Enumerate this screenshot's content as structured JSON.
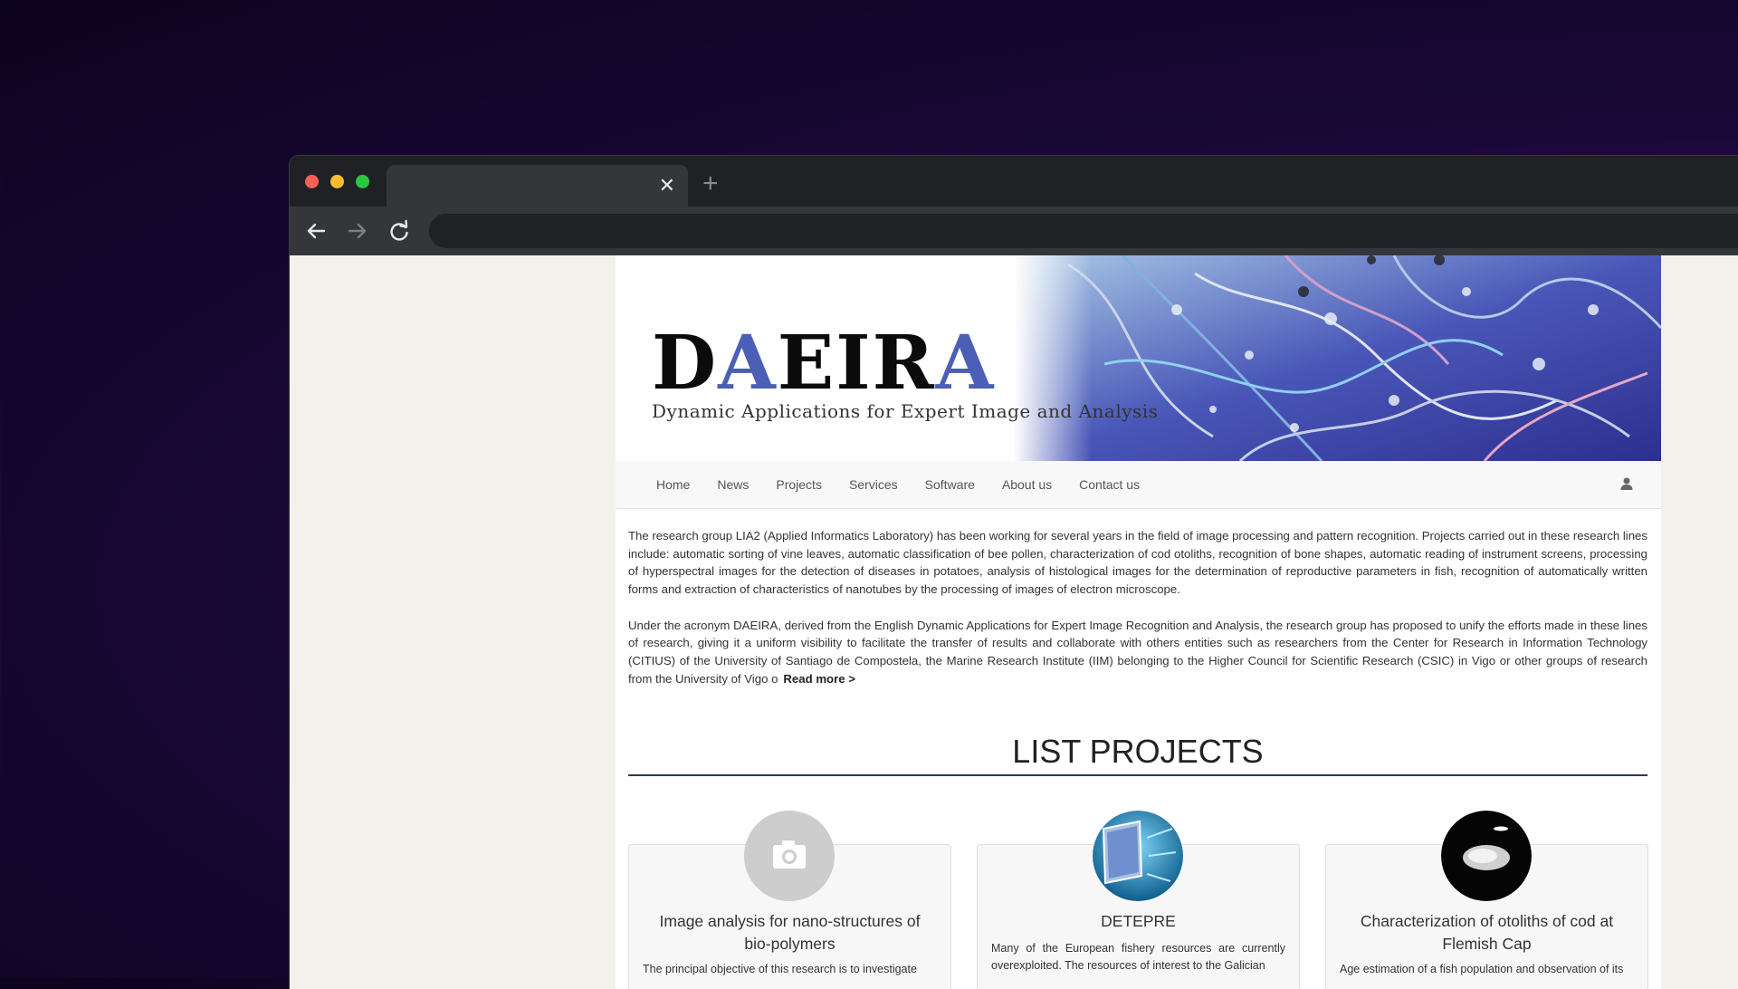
{
  "browser": {
    "tab_title": "",
    "tab_close": "✕",
    "new_tab": "+",
    "url": ""
  },
  "site": {
    "logo_text_parts": [
      "D",
      "A",
      "EIR",
      "A"
    ],
    "logo_subtitle": "Dynamic Applications for Expert Image and Analysis"
  },
  "nav": {
    "items": [
      "Home",
      "News",
      "Projects",
      "Services",
      "Software",
      "About us",
      "Contact us"
    ]
  },
  "intro": {
    "paragraph1": "The research group LIA2 (Applied Informatics Laboratory) has been working for several years in the field of image processing and pattern recognition. Projects carried out in these research lines include: automatic sorting of vine leaves, automatic classification of bee pollen, characterization of cod otoliths, recognition of bone shapes, automatic reading of instrument screens, processing of hyperspectral images for the detection of diseases in potatoes, analysis of histological images for the determination of reproductive parameters in fish, recognition of automatically written forms and extraction of characteristics of nanotubes by the processing of images of electron microscope.",
    "paragraph2": "Under the acronym DAEIRA, derived from the English Dynamic Applications for Expert Image Recognition and Analysis, the research group has proposed to unify the efforts made in these lines of research, giving it a uniform visibility to facilitate the transfer of results and collaborate with others entities such as researchers from the Center for Research in Information Technology (CITIUS) of the University of Santiago de Compostela, the Marine Research Institute (IIM) belonging to the Higher Council for Scientific Research (CSIC) in Vigo or other groups of research from the University of Vigo o",
    "read_more": "Read more >"
  },
  "projects": {
    "title": "LIST PROJECTS",
    "cards": [
      {
        "title": "Image analysis for nano-structures of bio-polymers",
        "description": "The principal objective of this research is to investigate",
        "image": "camera-placeholder-icon"
      },
      {
        "title": "DETEPRE",
        "description": "Many of the European fishery resources are currently overexploited. The resources of interest to the Galician",
        "image": "underwater-screen-image"
      },
      {
        "title": "Characterization of otoliths of cod at Flemish Cap",
        "description": "Age estimation of a fish population and observation of its",
        "image": "otolith-image"
      }
    ]
  }
}
